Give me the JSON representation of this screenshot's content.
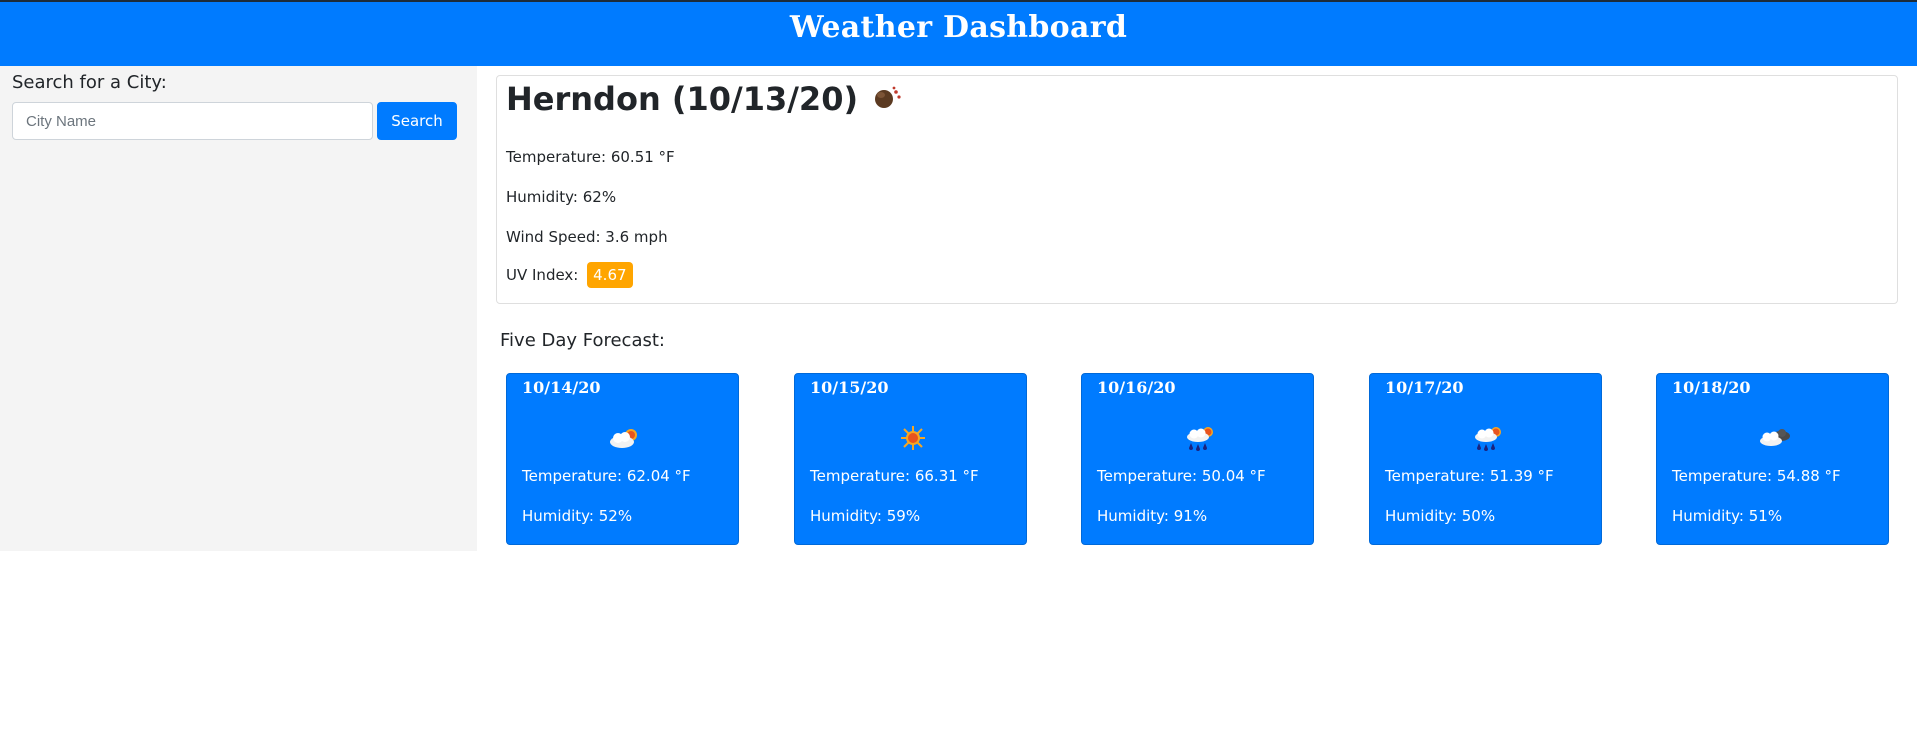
{
  "header": {
    "title": "Weather Dashboard"
  },
  "search": {
    "heading": "Search for a City:",
    "placeholder": "City Name",
    "value": "",
    "button_label": "Search"
  },
  "current": {
    "title": "Herndon (10/13/20)",
    "icon": "smoke-haze-icon",
    "temperature": "Temperature: 60.51 °F",
    "humidity": "Humidity: 62%",
    "wind": "Wind Speed: 3.6 mph",
    "uv_label": "UV Index:",
    "uv_value": "4.67",
    "uv_color": "#ffa500"
  },
  "forecast": {
    "heading": "Five Day Forecast:",
    "days": [
      {
        "date": "10/14/20",
        "icon": "few-clouds-icon",
        "temperature": "Temperature: 62.04 °F",
        "humidity": "Humidity: 52%"
      },
      {
        "date": "10/15/20",
        "icon": "clear-sun-icon",
        "temperature": "Temperature: 66.31 °F",
        "humidity": "Humidity: 59%"
      },
      {
        "date": "10/16/20",
        "icon": "rain-sun-icon",
        "temperature": "Temperature: 50.04 °F",
        "humidity": "Humidity: 91%"
      },
      {
        "date": "10/17/20",
        "icon": "rain-sun-icon",
        "temperature": "Temperature: 51.39 °F",
        "humidity": "Humidity: 50%"
      },
      {
        "date": "10/18/20",
        "icon": "broken-clouds-icon",
        "temperature": "Temperature: 54.88 °F",
        "humidity": "Humidity: 51%"
      }
    ]
  },
  "colors": {
    "primary": "#007bff",
    "sidebar_bg": "#f4f4f4",
    "uv_moderate": "#ffa500"
  }
}
